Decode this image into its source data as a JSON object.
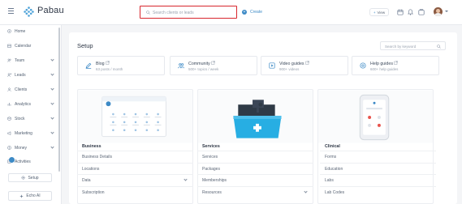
{
  "app": {
    "brand": "Pabau"
  },
  "header": {
    "search_placeholder": "Search clients or leads",
    "create_label": "Create",
    "view_label": "View"
  },
  "sidebar": {
    "items": [
      {
        "label": "Home",
        "icon": "home-icon",
        "expandable": false
      },
      {
        "label": "Calendar",
        "icon": "calendar-icon",
        "expandable": false
      },
      {
        "label": "Team",
        "icon": "team-icon",
        "expandable": true
      },
      {
        "label": "Leads",
        "icon": "leads-icon",
        "expandable": true
      },
      {
        "label": "Clients",
        "icon": "clients-icon",
        "expandable": true
      },
      {
        "label": "Analytics",
        "icon": "analytics-icon",
        "expandable": true
      },
      {
        "label": "Stock",
        "icon": "stock-icon",
        "expandable": true
      },
      {
        "label": "Marketing",
        "icon": "marketing-icon",
        "expandable": true
      },
      {
        "label": "Money",
        "icon": "money-icon",
        "expandable": true
      },
      {
        "label": "Activities",
        "icon": "activities-icon",
        "expandable": false
      }
    ],
    "setup_label": "Setup",
    "echo_label": "Echo AI"
  },
  "main": {
    "title": "Setup",
    "keyword_placeholder": "Search by keyword",
    "resources": [
      {
        "title": "Blog",
        "subtitle": "63 posts / month",
        "icon": "blog-icon"
      },
      {
        "title": "Community",
        "subtitle": "500+ topics / week",
        "icon": "community-icon"
      },
      {
        "title": "Video guides",
        "subtitle": "900+ videos",
        "icon": "video-icon"
      },
      {
        "title": "Help guides",
        "subtitle": "600+ help guides",
        "icon": "help-icon"
      }
    ],
    "columns": [
      {
        "title": "Business",
        "rows": [
          "Business Details",
          "Locations",
          "Data",
          "Subscription"
        ],
        "expandable_rows": [
          2
        ]
      },
      {
        "title": "Services",
        "rows": [
          "Services",
          "Packages",
          "Memberships",
          "Resources"
        ],
        "expandable_rows": [
          3
        ]
      },
      {
        "title": "Clinical",
        "rows": [
          "Forms",
          "Education",
          "Labs",
          "Lab Codes"
        ],
        "expandable_rows": []
      }
    ]
  },
  "colors": {
    "accent": "#3d8ac6",
    "search_highlight": "#d8262d",
    "sidebar_text": "#536072"
  }
}
